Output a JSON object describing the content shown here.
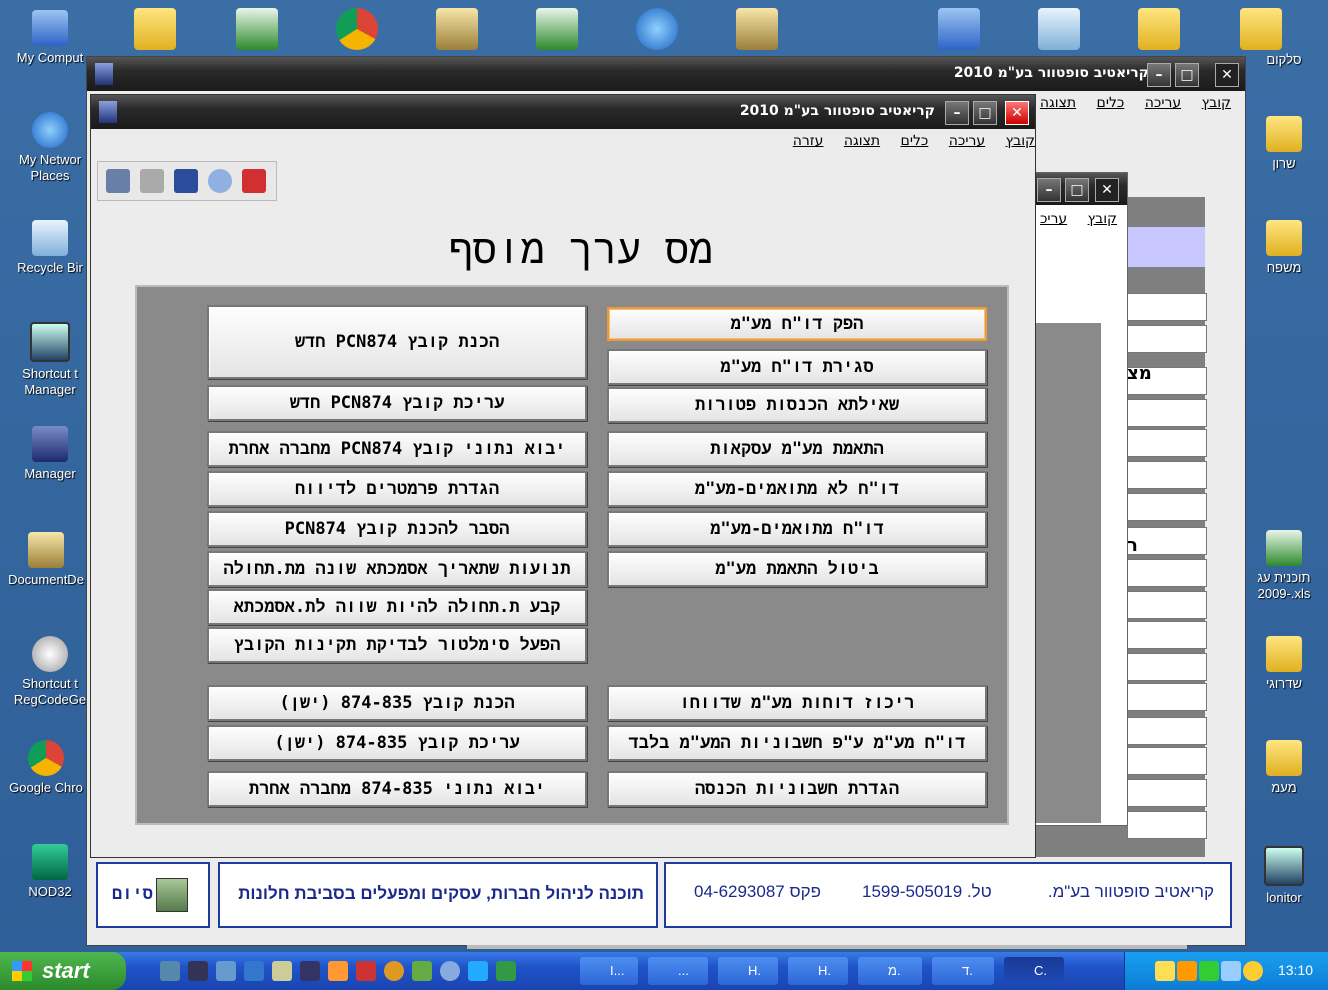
{
  "desktop": {
    "left_icons": [
      {
        "label": "My Comput",
        "icon": "my-computer-icon"
      },
      {
        "label": "My Networ Places",
        "icon": "network-icon"
      },
      {
        "label": "Recycle Bir",
        "icon": "recycle-bin-icon"
      },
      {
        "label": "Shortcut t Manager",
        "icon": "monitor-icon"
      },
      {
        "label": "Manager",
        "icon": "manager-icon"
      },
      {
        "label": "DocumentDe",
        "icon": "document-icon"
      },
      {
        "label": "Shortcut t RegCodeGe",
        "icon": "search-icon"
      },
      {
        "label": "Google Chro",
        "icon": "chrome-icon"
      },
      {
        "label": "NOD32",
        "icon": "nod32-icon"
      }
    ],
    "right_icons": [
      {
        "label": "סלקום",
        "icon": "folder-icon"
      },
      {
        "label": "שרון",
        "icon": "folder-icon"
      },
      {
        "label": "משפח",
        "icon": "folder-icon"
      },
      {
        "label": "תוכנית עג -2009.xls",
        "icon": "excel-file-icon"
      },
      {
        "label": "שדרוגי",
        "icon": "folder-icon"
      },
      {
        "label": "מעמ",
        "icon": "folder-icon"
      },
      {
        "label": "lonitor",
        "icon": "monitor-icon"
      }
    ]
  },
  "back_window": {
    "title": "קריאטיב סופטוור בע\"מ 2010",
    "menu": [
      "קובץ",
      "עריכה",
      "כלים",
      "תצוגה"
    ],
    "fragment_text_1": "מצ",
    "fragment_text_2": "ר"
  },
  "mid_window": {
    "menu": [
      "קובץ",
      "עריכ"
    ]
  },
  "main_window": {
    "title": "קריאטיב סופטוור בע\"מ 2010",
    "menu": [
      "קובץ",
      "עריכה",
      "כלים",
      "תצוגה",
      "עזרה"
    ],
    "heading": "מס ערך מוסף",
    "left_buttons": [
      "הכנת קובץ PCN874 חדש",
      "עריכת קובץ PCN874 חדש",
      "יבוא נתוני קובץ PCN874 מחברה אחרת",
      "הגדרת פרמטרים לדיווח",
      "הסבר להכנת קובץ PCN874",
      "תנועות שתאריך אסמכתא שונה מת.תחולה",
      "קבע ת.תחולה להיות שווה לת.אסמכתא",
      "הפעל סימלטור לבדיקת תקינות הקובץ",
      "הכנת קובץ 874-835 (ישן)",
      "עריכת קובץ 874-835 (ישן)",
      "יבוא נתוני 874-835 מחברה אחרת"
    ],
    "right_buttons": [
      "הפק דו\"ח מע\"מ",
      "סגירת דו\"ח מע\"מ",
      "שאילתא הכנסות פטורות",
      "התאמת מע\"מ עסקאות",
      "דו\"ח לא מתואמים-מע\"מ",
      "דו\"ח מתואמים-מע\"מ",
      "ביטול התאמת מע\"מ",
      "ריכוז דוחות מע\"מ שדווחו",
      "דו\"ח מע\"מ ע\"פ חשבוניות המע\"מ בלבד",
      "הגדרת חשבוניות הכנסה"
    ]
  },
  "status": {
    "exit_label": "סיום",
    "tagline": "תוכנה לניהול חברות, עסקים ומפעלים בסביבת חלונות",
    "company": "קריאטיב סופטוור בע\"מ.",
    "phone": "טל. 1599-505019",
    "fax": "פקס 04-6293087"
  },
  "taskbar": {
    "start_label": "start",
    "tasks": [
      "I...",
      "...",
      "H.",
      "H.",
      "מ.",
      "ד.",
      "C."
    ],
    "clock": "13:10"
  },
  "colors": {
    "accent": "#1f3b9c",
    "focus": "#e89a3c",
    "panel": "#8a8a8a"
  }
}
